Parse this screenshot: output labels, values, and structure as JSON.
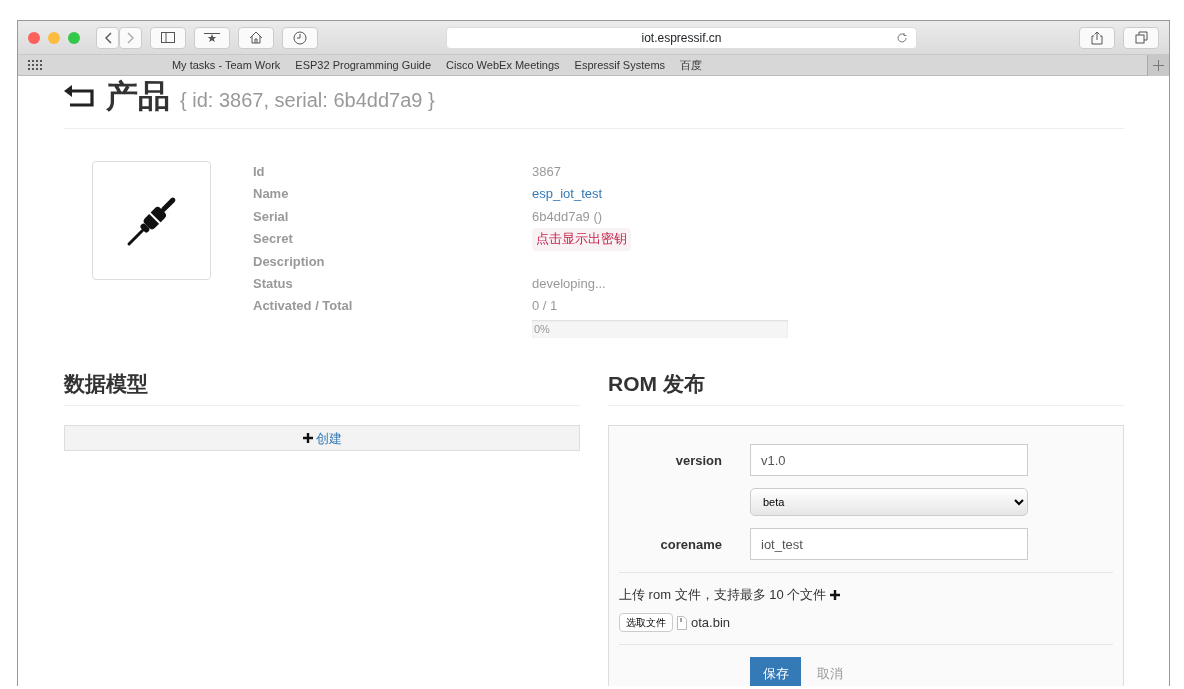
{
  "window": {
    "url": "iot.espressif.cn",
    "bookmarks": [
      "My tasks - Team Work",
      "ESP32 Programming Guide",
      "Cisco WebEx Meetings",
      "Espressif Systems",
      "百度"
    ]
  },
  "page": {
    "title": "产品",
    "subtitle": "{ id: 3867, serial: 6b4dd7a9 }"
  },
  "details": [
    {
      "label": "Id",
      "value": "3867",
      "kind": "text"
    },
    {
      "label": "Name",
      "value": "esp_iot_test",
      "kind": "link"
    },
    {
      "label": "Serial",
      "value": "6b4dd7a9 ()",
      "kind": "text"
    },
    {
      "label": "Secret",
      "value": "点击显示出密钥",
      "kind": "secret"
    },
    {
      "label": "Description"
    },
    {
      "label": "Status",
      "value": "developing...",
      "kind": "text"
    },
    {
      "label": "Activated / Total",
      "value": "0 / 1",
      "kind": "text"
    }
  ],
  "progress": {
    "level": 0,
    "text": "0%"
  },
  "data_model": {
    "title": "数据模型",
    "create_label": "创建"
  },
  "rom": {
    "title": "ROM 发布",
    "version": {
      "label": "version",
      "value": "v1.0"
    },
    "channel": {
      "value": "beta"
    },
    "corename": {
      "label": "corename",
      "value": "iot_test"
    },
    "upload_label": "上传 rom 文件，支持最多 10 个文件",
    "file_button": "选取文件",
    "file_name": "ota.bin",
    "save": "保存",
    "cancel": "取消"
  }
}
